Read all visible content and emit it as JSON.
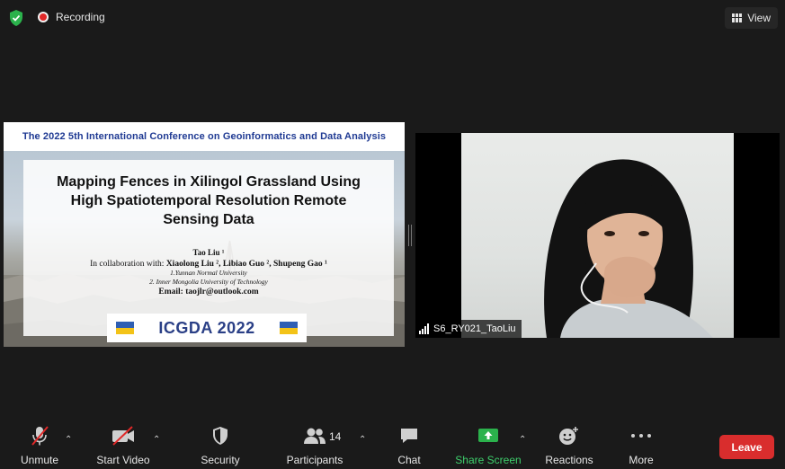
{
  "top_bar": {
    "recording_label": "Recording",
    "view_label": "View"
  },
  "shared_screen": {
    "conference_header": "The 2022 5th International Conference on Geoinformatics and Data Analysis",
    "title": "Mapping Fences in Xilingol Grassland Using High Spatiotemporal Resolution Remote Sensing Data",
    "author": "Tao Liu ¹",
    "collab_prefix": "In collaboration with:",
    "collaborators": "Xiaolong Liu ², Libiao Guo ², Shupeng Gao ¹",
    "affiliation_1": "1.Yunnan Normal University",
    "affiliation_2": "2. Inner Mongolia University of Technology",
    "email": "Email: taojlr@outlook.com",
    "logo_text": "ICGDA 2022"
  },
  "participant": {
    "name": "S6_RY021_TaoLiu"
  },
  "toolbar": {
    "unmute_label": "Unmute",
    "start_video_label": "Start Video",
    "security_label": "Security",
    "participants_label": "Participants",
    "participants_count": "14",
    "chat_label": "Chat",
    "share_screen_label": "Share Screen",
    "reactions_label": "Reactions",
    "more_label": "More",
    "leave_label": "Leave"
  },
  "colors": {
    "accent_green": "#3ecf6c",
    "leave_red": "#d92d2d",
    "background": "#1a1a1a"
  }
}
